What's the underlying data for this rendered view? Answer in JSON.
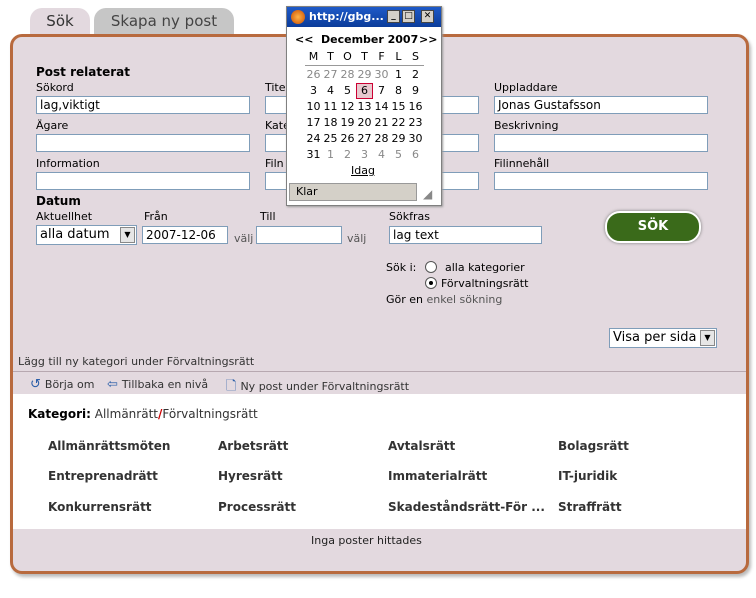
{
  "tabs": {
    "search": "Sök",
    "create": "Skapa ny post"
  },
  "form": {
    "section_post": "Post relaterat",
    "sokord_label": "Sökord",
    "sokord_value": "lag,viktigt",
    "titel_label": "Tite",
    "uppladdare_label": "Uppladdare",
    "uppladdare_value": "Jonas Gustafsson",
    "agare_label": "Ägare",
    "kategori_label": "Kate",
    "beskrivning_label": "Beskrivning",
    "information_label": "Information",
    "filnamn_label": "Filn",
    "filinnehall_label": "Filinnehåll",
    "section_datum": "Datum",
    "aktuellhet_label": "Aktuellhet",
    "aktuellhet_value": "alla datum",
    "fran_label": "Från",
    "fran_value": "2007-12-06",
    "valj_1": "välj",
    "till_label": "Till",
    "valj_2": "välj",
    "sokfras_label": "Sökfras",
    "sokfras_value": "lag text",
    "search_button": "SÖK",
    "sok_i_label": "Sök i:",
    "radio_all": "alla kategorier",
    "radio_forv": "Förvaltningsrätt",
    "simple_prefix": "Gör en",
    "simple_link": "enkel sökning",
    "per_page_value": "Visa per sida"
  },
  "add_category": "Lägg till ny kategori under Förvaltningsrätt",
  "toolbar": {
    "restart": "Börja om",
    "back": "Tillbaka en nivå",
    "new_post": "Ny post under Förvaltningsrätt"
  },
  "breadcrumb": {
    "label": "Kategori:",
    "root": "Allmänrätt",
    "sep": "/",
    "current": "Förvaltningsrätt"
  },
  "categories": [
    [
      "Allmänrättsmöten",
      "Arbetsrätt",
      "Avtalsrätt",
      "Bolagsrätt"
    ],
    [
      "Entreprenadrätt",
      "Hyresrätt",
      "Immaterialrätt",
      "IT-juridik"
    ],
    [
      "Konkurrensrätt",
      "Processrätt",
      "Skadeståndsrätt-För ...",
      "Straffrätt"
    ]
  ],
  "no_posts": "Inga poster hittades",
  "popup": {
    "title": "http://gbg...",
    "prev": "<<",
    "month": "December 2007",
    "next": ">>",
    "weekdays": [
      "M",
      "T",
      "O",
      "T",
      "F",
      "L",
      "S"
    ],
    "weeks": [
      [
        [
          "26",
          "o"
        ],
        [
          "27",
          "o"
        ],
        [
          "28",
          "o"
        ],
        [
          "29",
          "o"
        ],
        [
          "30",
          "o"
        ],
        [
          "1",
          "c"
        ],
        [
          "2",
          "c"
        ]
      ],
      [
        [
          "3",
          "c"
        ],
        [
          "4",
          "c"
        ],
        [
          "5",
          "c"
        ],
        [
          "6",
          "s"
        ],
        [
          "7",
          "c"
        ],
        [
          "8",
          "c"
        ],
        [
          "9",
          "c"
        ]
      ],
      [
        [
          "10",
          "c"
        ],
        [
          "11",
          "c"
        ],
        [
          "12",
          "c"
        ],
        [
          "13",
          "c"
        ],
        [
          "14",
          "c"
        ],
        [
          "15",
          "c"
        ],
        [
          "16",
          "c"
        ]
      ],
      [
        [
          "17",
          "c"
        ],
        [
          "18",
          "c"
        ],
        [
          "19",
          "c"
        ],
        [
          "20",
          "c"
        ],
        [
          "21",
          "c"
        ],
        [
          "22",
          "c"
        ],
        [
          "23",
          "c"
        ]
      ],
      [
        [
          "24",
          "c"
        ],
        [
          "25",
          "c"
        ],
        [
          "26",
          "c"
        ],
        [
          "27",
          "c"
        ],
        [
          "28",
          "c"
        ],
        [
          "29",
          "c"
        ],
        [
          "30",
          "c"
        ]
      ],
      [
        [
          "31",
          "c"
        ],
        [
          "1",
          "o"
        ],
        [
          "2",
          "o"
        ],
        [
          "3",
          "o"
        ],
        [
          "4",
          "o"
        ],
        [
          "5",
          "o"
        ],
        [
          "6",
          "o"
        ]
      ]
    ],
    "today_link": "Idag",
    "status": "Klar"
  },
  "colors": {
    "panel_bg": "#e3d9df",
    "panel_border": "#b86a3e",
    "search_button": "#3a6a1a",
    "breadcrumb_sep": "#cc0000"
  }
}
